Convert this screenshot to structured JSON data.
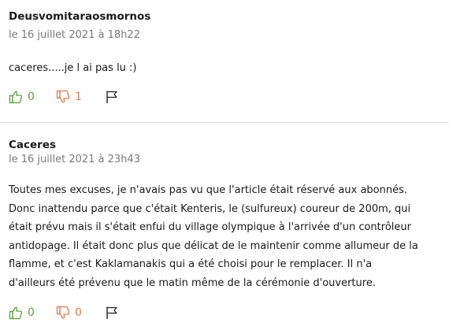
{
  "comments": [
    {
      "author": "Deusvomitaraosmornos",
      "date": "le 16 juillet 2021 à 18h22",
      "lines": [
        "caceres.....je l ai pas lu :)"
      ],
      "likes": "0",
      "dislikes": "1"
    },
    {
      "author": "Caceres",
      "date": "le 16 juillet 2021 à 23h43",
      "lines": [
        "Toutes mes excuses, je n'avais pas vu que l'article était réservé aux abonnés.",
        "Donc inattendu parce que c'était Kenteris, le (sulfureux) coureur de 200m, qui",
        "était prévu mais il s'était enfui du village olympique à l'arrivée d'un contrôleur",
        "antidopage. Il était donc plus que délicat de le maintenir comme allumeur de la",
        "flamme, et c'est Kaklamanakis qui a été choisi pour le remplacer. Il n'a",
        "d'ailleurs été prévenu que le matin même de la cérémonie d'ouverture."
      ],
      "likes": "0",
      "dislikes": "0"
    }
  ],
  "icons": {
    "like": "thumbs-up-icon",
    "dislike": "thumbs-down-icon",
    "report": "flag-icon"
  },
  "colors": {
    "like": "#5aa338",
    "dislike": "#e07a4a",
    "date": "#7a7a7a",
    "divider": "#dcdcdc"
  }
}
